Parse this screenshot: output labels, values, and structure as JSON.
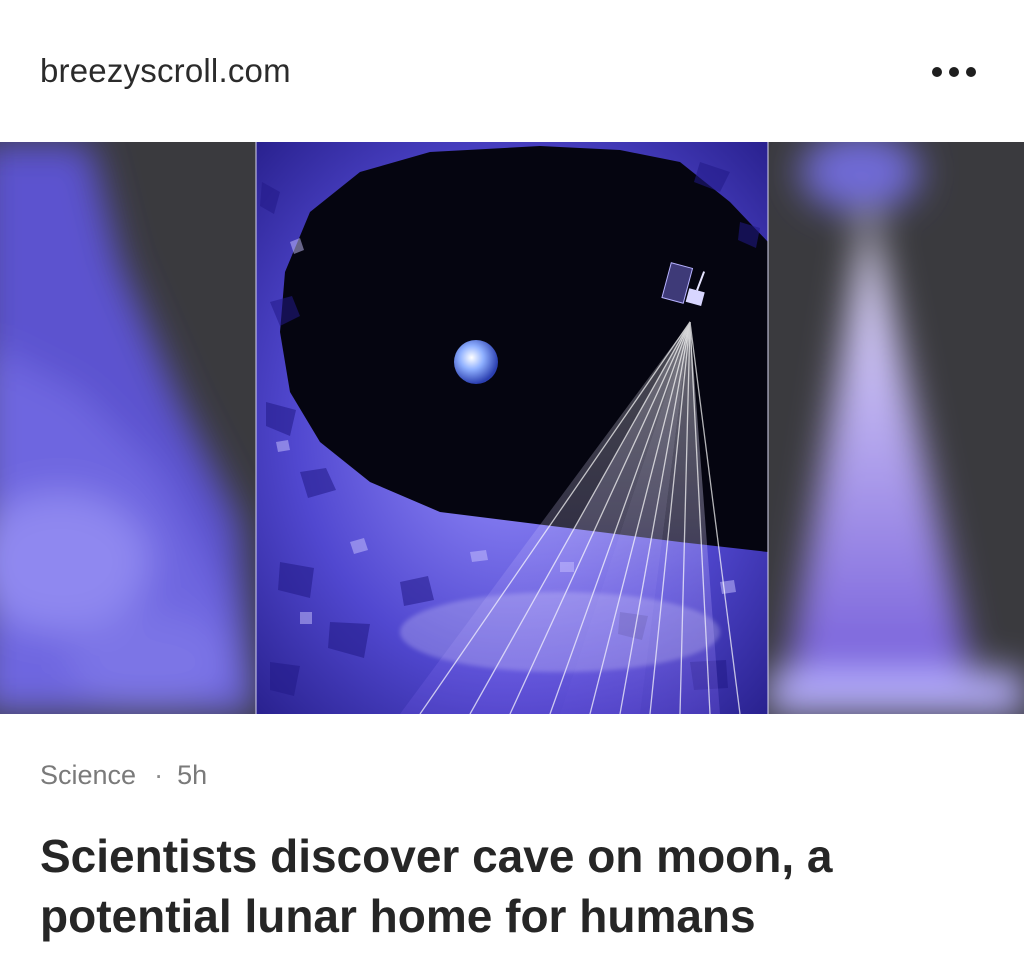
{
  "header": {
    "source": "breezyscroll.com",
    "more_icon": "more-horizontal-icon"
  },
  "hero_image": {
    "subject": "moon-cave-illustration",
    "colors": {
      "accent": "#5a4fd6",
      "space": "#050510",
      "blur_bg": "#3b3b3f"
    }
  },
  "article": {
    "category": "Science",
    "separator": "·",
    "age": "5h",
    "headline": "Scientists discover cave on moon, a potential lunar home for humans"
  }
}
